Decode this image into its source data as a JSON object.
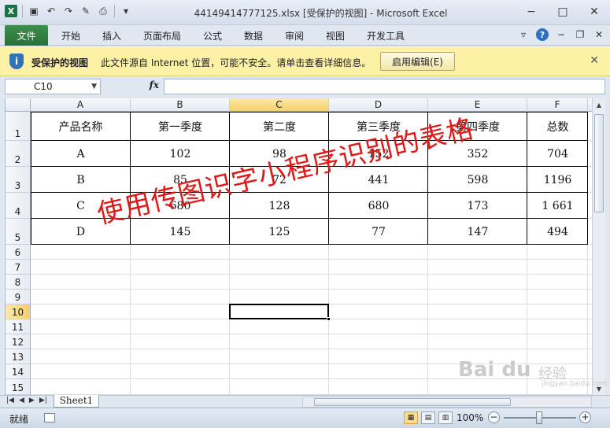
{
  "window": {
    "title": "44149414777125.xlsx  [受保护的视图] - Microsoft Excel",
    "minimize": "−",
    "maximize": "□",
    "close": "✕"
  },
  "ribbon": {
    "file_tab": "文件",
    "tabs": [
      "开始",
      "插入",
      "页面布局",
      "公式",
      "数据",
      "审阅",
      "视图",
      "开发工具"
    ]
  },
  "protected_view": {
    "label": "受保护的视图",
    "message": "此文件源自 Internet 位置，可能不安全。请单击查看详细信息。",
    "enable_button": "启用编辑(E)",
    "close": "✕"
  },
  "formula_bar": {
    "name_box": "C10",
    "fx": "fx",
    "formula": ""
  },
  "grid": {
    "columns": [
      "A",
      "B",
      "C",
      "D",
      "E",
      "F"
    ],
    "selected_column": "C",
    "rows": [
      "1",
      "2",
      "3",
      "4",
      "5",
      "6",
      "7",
      "8",
      "9",
      "10",
      "11",
      "12",
      "13",
      "14",
      "15"
    ],
    "selected_row": "10",
    "header": [
      "产品名称",
      "第一季度",
      "第二度",
      "第三季度",
      "第四季度",
      "总数"
    ],
    "data": [
      [
        "A",
        "102",
        "98",
        "152",
        "352",
        "704"
      ],
      [
        "B",
        "85",
        "72",
        "441",
        "598",
        "1196"
      ],
      [
        "C",
        "680",
        "128",
        "680",
        "173",
        "1 661"
      ],
      [
        "D",
        "145",
        "125",
        "77",
        "147",
        "494"
      ]
    ]
  },
  "overlay_text": "使用传图识字小程序识别的表格",
  "sheet_tabs": [
    "Sheet1"
  ],
  "status": {
    "ready": "就绪",
    "zoom": "100%"
  },
  "watermark": {
    "brand": "Bai du",
    "sub": "经验",
    "url": "jingyan.baidu.com"
  }
}
